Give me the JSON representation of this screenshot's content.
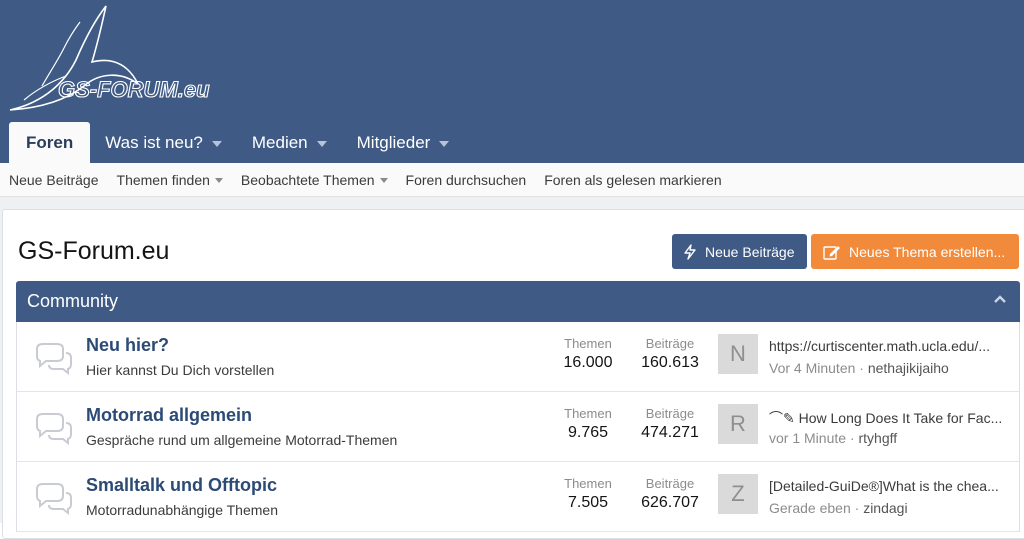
{
  "site": {
    "logo_text": "GS-FORUM.eu"
  },
  "nav": {
    "tabs": [
      {
        "label": "Foren",
        "active": true,
        "has_dropdown": false
      },
      {
        "label": "Was ist neu?",
        "active": false,
        "has_dropdown": true
      },
      {
        "label": "Medien",
        "active": false,
        "has_dropdown": true
      },
      {
        "label": "Mitglieder",
        "active": false,
        "has_dropdown": true
      }
    ]
  },
  "subnav": {
    "items": [
      {
        "label": "Neue Beiträge",
        "has_dropdown": false
      },
      {
        "label": "Themen finden",
        "has_dropdown": true
      },
      {
        "label": "Beobachtete Themen",
        "has_dropdown": true
      },
      {
        "label": "Foren durchsuchen",
        "has_dropdown": false
      },
      {
        "label": "Foren als gelesen markieren",
        "has_dropdown": false
      }
    ]
  },
  "page": {
    "title": "GS-Forum.eu",
    "buttons": {
      "new_posts": {
        "label": "Neue Beiträge",
        "icon": "bolt-icon"
      },
      "new_thread": {
        "label": "Neues Thema erstellen...",
        "icon": "pencil-square-icon"
      }
    }
  },
  "category": {
    "title": "Community",
    "nodes": [
      {
        "title": "Neu hier?",
        "description": "Hier kannst Du Dich vorstellen",
        "threads_label": "Themen",
        "threads": "16.000",
        "posts_label": "Beiträge",
        "posts": "160.613",
        "avatar_letter": "N",
        "last_title": "https://curtiscenter.math.ucla.edu/...",
        "last_time": "Vor 4 Minuten",
        "last_user": "nethajikijaiho"
      },
      {
        "title": "Motorrad allgemein",
        "description": "Gespräche rund um allgemeine Motorrad-Themen",
        "threads_label": "Themen",
        "threads": "9.765",
        "posts_label": "Beiträge",
        "posts": "474.271",
        "avatar_letter": "R",
        "last_title": "⌒✎ How Long Does It Take for Fac...",
        "last_time": "vor 1 Minute",
        "last_user": "rtyhgff"
      },
      {
        "title": "Smalltalk und Offtopic",
        "description": "Motorradunabhängige Themen",
        "threads_label": "Themen",
        "threads": "7.505",
        "posts_label": "Beiträge",
        "posts": "626.707",
        "avatar_letter": "Z",
        "last_title": "[Detailed-GuiDe®]What is the chea...",
        "last_time": "Gerade eben",
        "last_user": "zindagi"
      }
    ]
  },
  "colors": {
    "header_bg": "#3e5a85",
    "accent_orange": "#f28a3c",
    "link_blue": "#2b4a75"
  }
}
